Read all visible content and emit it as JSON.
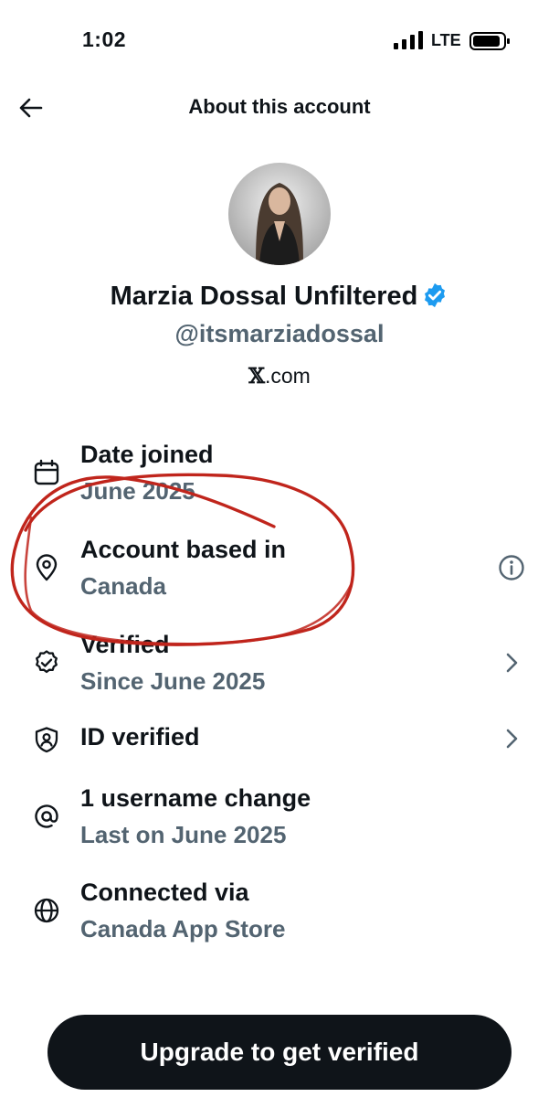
{
  "status_bar": {
    "time": "1:02",
    "network": "LTE",
    "icons": [
      "signal-bars-icon",
      "battery-icon"
    ]
  },
  "header": {
    "title": "About this account",
    "back_icon": "back-arrow-icon"
  },
  "profile": {
    "display_name": "Marzia Dossal Unfiltered",
    "handle": "@itsmarziadossal",
    "source_mark": "𝕏",
    "source_text": ".com",
    "verified_badge_color": "#1d9bf0"
  },
  "rows": [
    {
      "icon": "calendar-icon",
      "label": "Date joined",
      "value": "June 2025",
      "trailing": null
    },
    {
      "icon": "location-pin-icon",
      "label": "Account based in",
      "value": "Canada",
      "trailing": "info-icon"
    },
    {
      "icon": "verified-badge-outline-icon",
      "label": "Verified",
      "value": "Since June 2025",
      "trailing": "chevron-right-icon"
    },
    {
      "icon": "shield-person-icon",
      "label": "ID verified",
      "value": "",
      "trailing": "chevron-right-icon"
    },
    {
      "icon": "at-sign-icon",
      "label": "1 username change",
      "value": "Last on June 2025",
      "trailing": null
    },
    {
      "icon": "globe-icon",
      "label": "Connected via",
      "value": "Canada App Store",
      "trailing": null
    }
  ],
  "cta": {
    "label": "Upgrade to get verified"
  },
  "colors": {
    "text_primary": "#0f1419",
    "text_secondary": "#536471",
    "button_bg": "#0f1419",
    "annotation_red": "#c0251c"
  }
}
